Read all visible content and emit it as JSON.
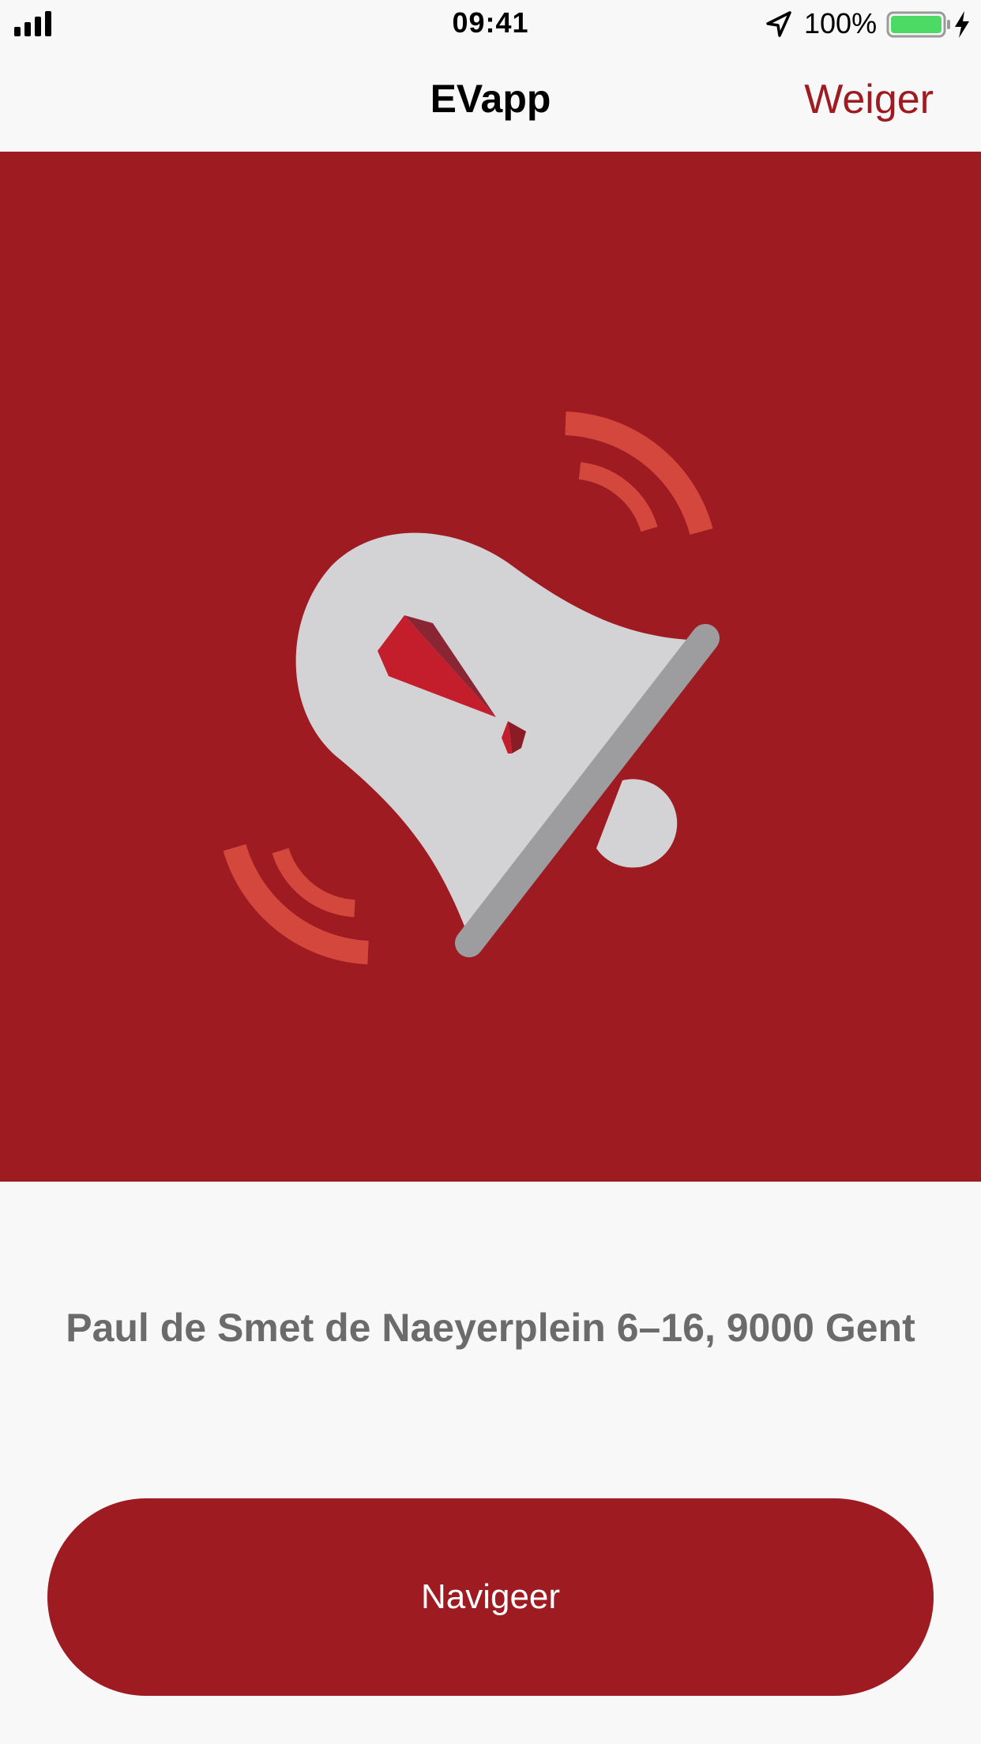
{
  "status_bar": {
    "time": "09:41",
    "battery_percent": "100%",
    "signal_icon": "cellular-signal-icon",
    "location_icon": "location-arrow-icon",
    "battery_icon": "battery-full-icon",
    "charging_icon": "charging-bolt-icon",
    "battery_color": "#4cd964"
  },
  "nav": {
    "title": "EVapp",
    "action_label": "Weiger",
    "accent_color": "#9e1b22"
  },
  "hero": {
    "illustration_icon": "ringing-alarm-bell-icon",
    "background_color": "#9e1b22"
  },
  "alert": {
    "address": "Paul de Smet de Naeyerplein 6–16, 9000 Gent"
  },
  "actions": {
    "navigate_label": "Navigeer"
  }
}
